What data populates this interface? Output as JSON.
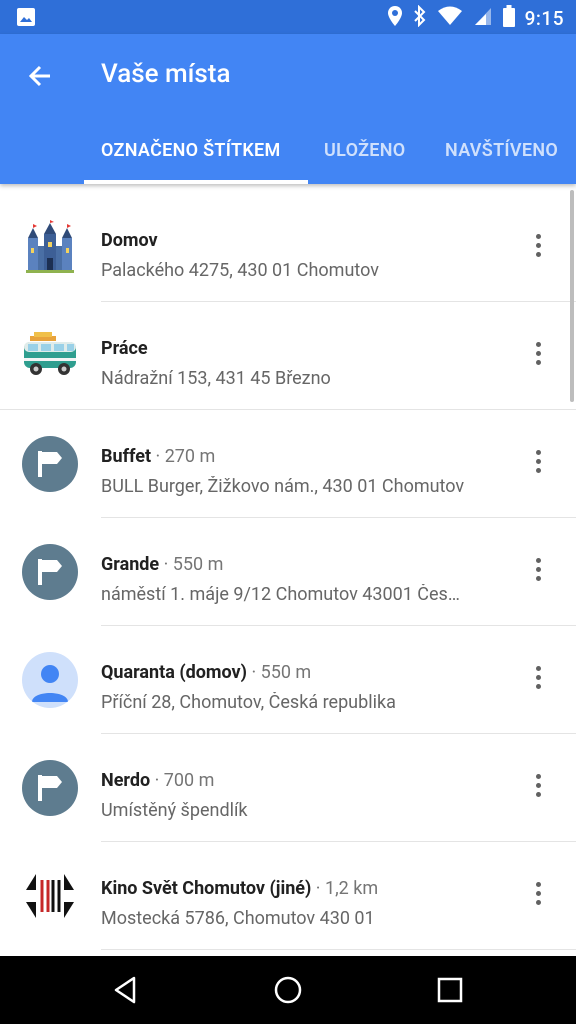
{
  "status_bar": {
    "time": "9:15"
  },
  "app_bar": {
    "title": "Vaše místa"
  },
  "tabs": [
    {
      "label": "OZNAČENO ŠTÍTKEM",
      "active": true
    },
    {
      "label": "ULOŽENO",
      "active": false
    },
    {
      "label": "NAVŠTÍVENO",
      "active": false
    }
  ],
  "places": [
    {
      "name": "Domov",
      "distance": "",
      "address": "Palackého 4275, 430 01 Chomutov",
      "icon": "castle-icon"
    },
    {
      "name": "Práce",
      "distance": "",
      "address": "Nádražní 153, 431 45 Březno",
      "icon": "van-icon"
    },
    {
      "name": "Buffet",
      "distance": " · 270 m",
      "address": "BULL Burger, Žižkovo nám., 430 01 Chomutov",
      "icon": "flag-icon"
    },
    {
      "name": "Grande",
      "distance": " · 550 m",
      "address": "náměstí 1. máje 9/12 Chomutov 43001 Čes…",
      "icon": "flag-icon"
    },
    {
      "name": "Quaranta (domov)",
      "distance": " · 550 m",
      "address": "Příční 28, Chomutov, Česká republika",
      "icon": "person-icon"
    },
    {
      "name": "Nerdo",
      "distance": " · 700 m",
      "address": "Umístěný špendlík",
      "icon": "flag-icon"
    },
    {
      "name": "Kino Svět Chomutov (jiné)",
      "distance": " · 1,2 km",
      "address": "Mostecká 5786, Chomutov 430 01",
      "icon": "kino-svet-logo-icon"
    }
  ],
  "colors": {
    "status_bar": "#2f6fd8",
    "app_bar": "#4285f4",
    "pin_avatar": "#5e7c8f",
    "nav_bar": "#000000"
  }
}
